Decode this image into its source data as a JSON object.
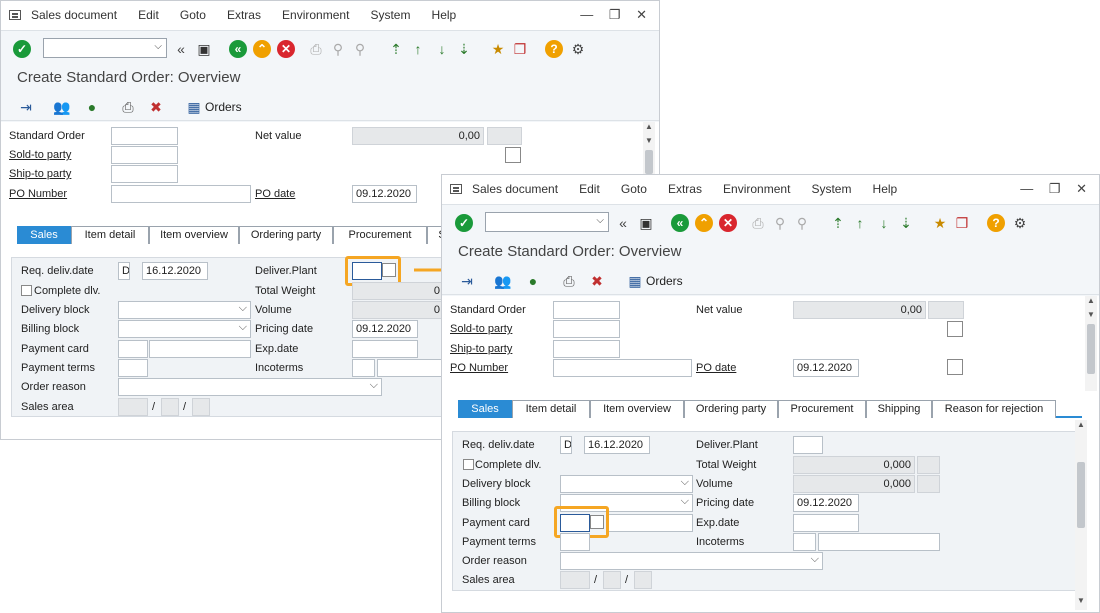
{
  "menu": [
    "Sales document",
    "Edit",
    "Goto",
    "Extras",
    "Environment",
    "System",
    "Help"
  ],
  "window_controls": "— ❐ ✕",
  "title": "Create Standard Order: Overview",
  "app_toolbar": {
    "orders_label": "Orders"
  },
  "header": {
    "standard_order_label": "Standard Order",
    "net_value_label": "Net value",
    "net_value": "0,00",
    "sold_to_label": "Sold-to party",
    "ship_to_label": "Ship-to party",
    "po_number_label": "PO Number",
    "po_date_label": "PO date",
    "po_date": "09.12.2020"
  },
  "tabs_back": [
    "Sales",
    "Item detail",
    "Item overview",
    "Ordering party",
    "Procurement",
    "S"
  ],
  "tabs_front": [
    "Sales",
    "Item detail",
    "Item overview",
    "Ordering party",
    "Procurement",
    "Shipping",
    "Reason for rejection"
  ],
  "sales": {
    "req_deliv_label": "Req. deliv.date",
    "req_deliv_type": "D",
    "req_deliv_date": "16.12.2020",
    "complete_dlv_label": "Complete dlv.",
    "delivery_block_label": "Delivery block",
    "billing_block_label": "Billing block",
    "payment_card_label": "Payment card",
    "payment_terms_label": "Payment terms",
    "order_reason_label": "Order reason",
    "sales_area_label": "Sales area",
    "slash": "/",
    "deliver_plant_label": "Deliver.Plant",
    "total_weight_label": "Total Weight",
    "total_weight": "0,000",
    "volume_label": "Volume",
    "volume": "0,000",
    "pricing_date_label": "Pricing date",
    "pricing_date": "09.12.2020",
    "exp_date_label": "Exp.date",
    "incoterms_label": "Incoterms",
    "back_weight_partial": "0",
    "back_volume_partial": "0"
  },
  "colors": {
    "accent": "#2a8bd4",
    "highlight": "#f5a623",
    "green": "#1a9a3a",
    "orange": "#f0a000",
    "red": "#d9262e"
  }
}
